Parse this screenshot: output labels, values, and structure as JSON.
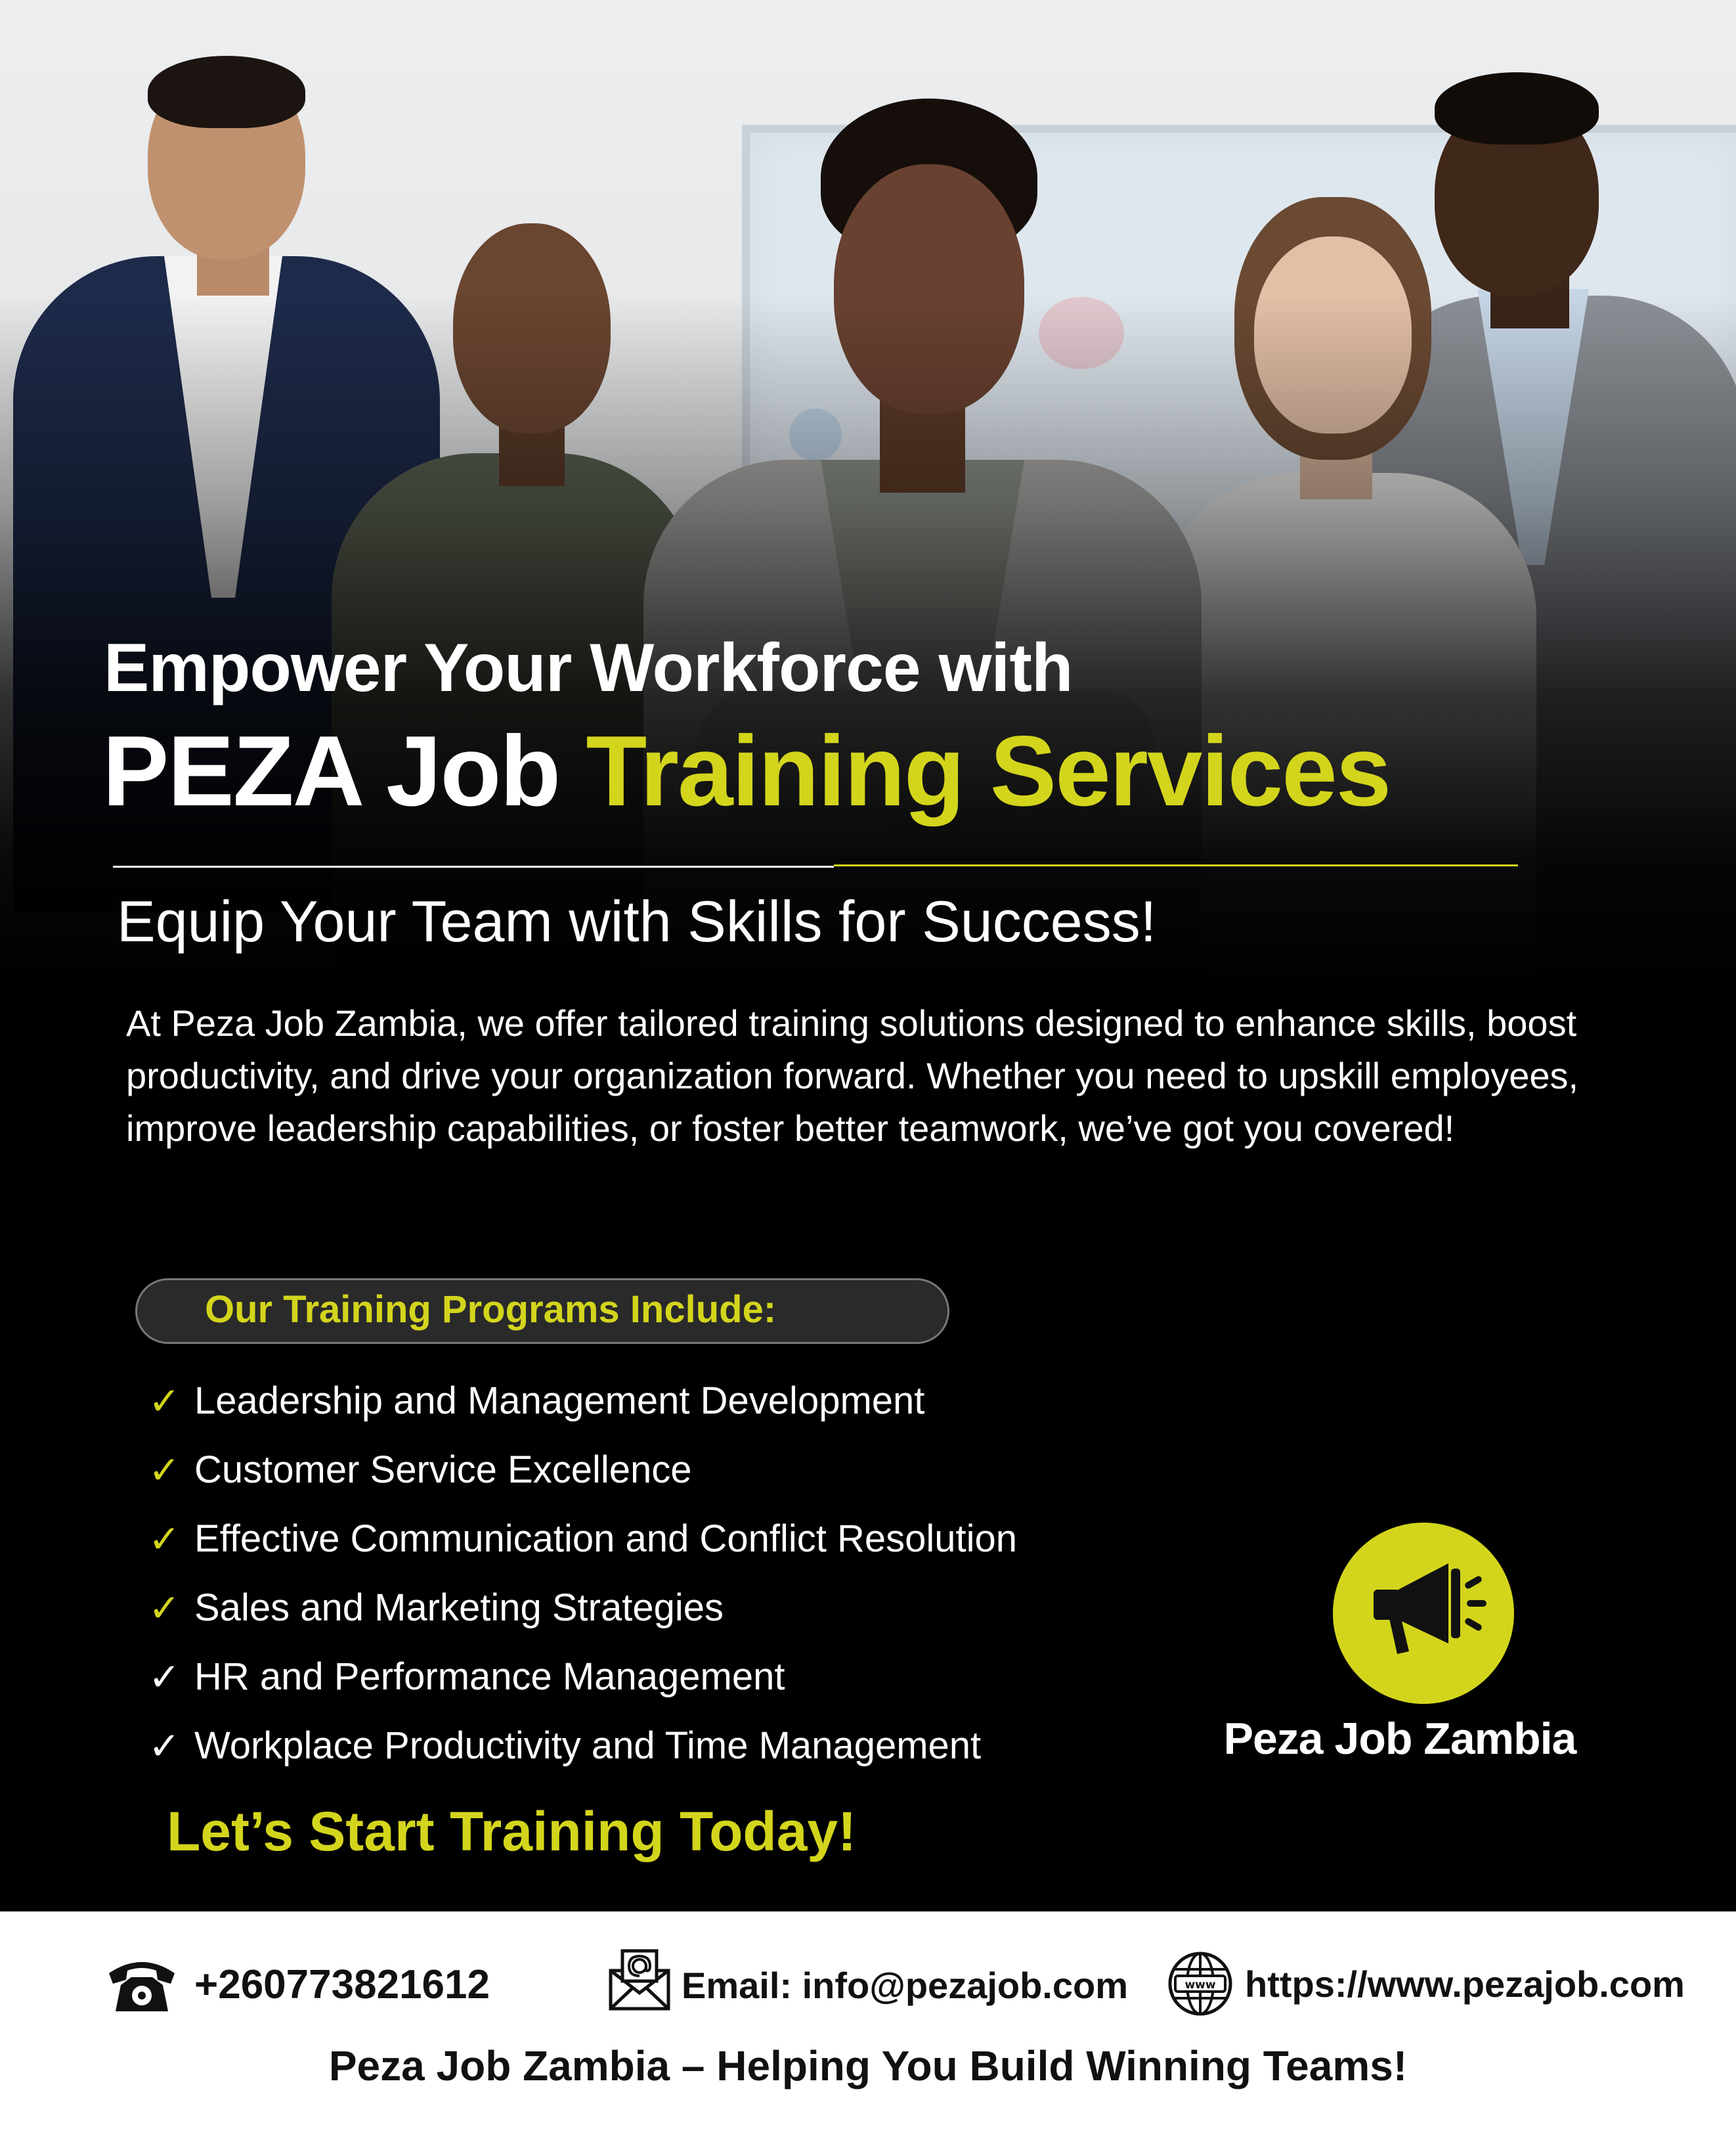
{
  "headline": {
    "line1": "Empower Your Workforce with",
    "line2_white": "PEZA Job ",
    "line2_yellow": "Training Services"
  },
  "subheadline": "Equip Your Team with Skills for Success!",
  "intro_text": "At Peza Job Zambia, we offer tailored training solutions designed to enhance skills, boost productivity, and drive your organization forward. Whether you need to upskill employees, improve leadership capabilities, or foster better teamwork, we’ve got you covered!",
  "programs": {
    "title": "Our Training Programs Include:",
    "items": [
      {
        "check": "✓",
        "label": " Leadership and Management Development",
        "check_color": "yellow"
      },
      {
        "check": "✓",
        "label": "Customer Service Excellence",
        "check_color": "yellow"
      },
      {
        "check": "✓",
        "label": " Effective Communication and Conflict Resolution",
        "check_color": "yellow"
      },
      {
        "check": "✓",
        "label": "Sales and Marketing Strategies",
        "check_color": "yellow"
      },
      {
        "check": "✓",
        "label": "HR and Performance Management",
        "check_color": "white"
      },
      {
        "check": "✓",
        "label": "Workplace Productivity and Time Management",
        "check_color": "white"
      }
    ]
  },
  "cta": "Let’s Start Training Today!",
  "brand": {
    "name": "Peza Job Zambia",
    "logo_icon": "megaphone-icon"
  },
  "footer": {
    "phone": "+260773821612",
    "email": "Email: info@pezajob.com",
    "website": "https://www.pezajob.com",
    "tagline": "Peza Job Zambia – Helping You Build Winning Teams!",
    "icons": [
      "telephone-icon",
      "email-icon",
      "globe-www-icon"
    ]
  },
  "colors": {
    "accent_yellow": "#d3d51c",
    "background": "#000000",
    "footer_background": "#ffffff"
  }
}
